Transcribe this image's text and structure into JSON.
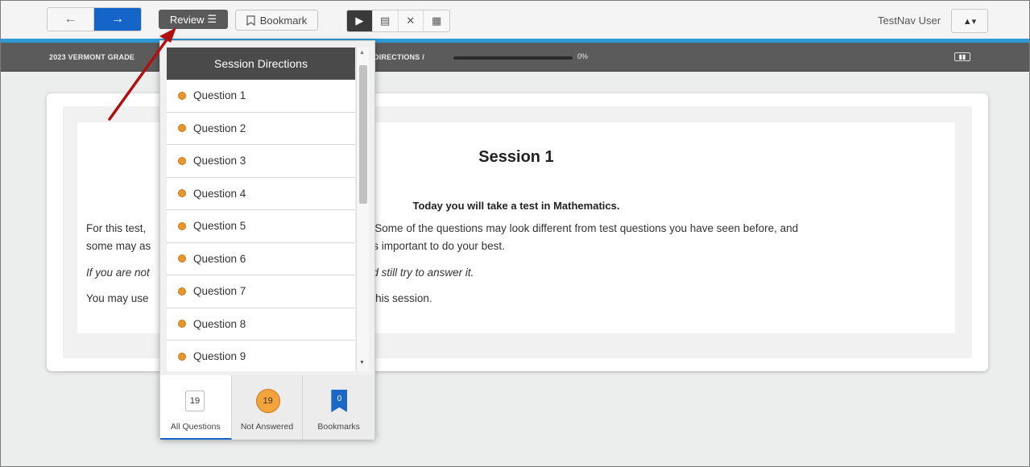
{
  "toolbar": {
    "back_icon": "←",
    "next_icon": "→",
    "review_label": "Review",
    "review_icon": "☰",
    "bookmark_label": "Bookmark",
    "user_name": "TestNav User",
    "user_icon": "▲▾",
    "tools": [
      {
        "name": "pointer-icon",
        "glyph": "▶"
      },
      {
        "name": "notepad-icon",
        "glyph": "▤"
      },
      {
        "name": "answer-eliminator-icon",
        "glyph": "✕"
      },
      {
        "name": "calculator-icon",
        "glyph": "▦"
      }
    ]
  },
  "strip": {
    "test_title": "2023 VERMONT GRADE",
    "section": "DIRECTIONS  /",
    "progress_percent": 0,
    "progress_text": "0%"
  },
  "content": {
    "title": "Session 1",
    "intro": "Today you will take a test in Mathematics.",
    "para1_line1": "For this test,",
    "para1_line1_end": "tions. Some of the questions may look different from test questions you have seen before, and",
    "para1_line2": "some may as",
    "para1_line2_end": "t it is important to do your best.",
    "para2": "If you are not",
    "para2_end": "hould still try to answer it.",
    "para3": "You may use",
    "para3_end": "s in this session."
  },
  "review_panel": {
    "header": "Session Directions",
    "questions": [
      "Question 1",
      "Question 2",
      "Question 3",
      "Question 4",
      "Question 5",
      "Question 6",
      "Question 7",
      "Question 8",
      "Question 9"
    ],
    "tabs": {
      "all": {
        "count": "19",
        "label": "All Questions"
      },
      "not_answered": {
        "count": "19",
        "label": "Not Answered"
      },
      "bookmarks": {
        "count": "0",
        "label": "Bookmarks"
      }
    }
  },
  "colors": {
    "accent_blue": "#1565c8",
    "unanswered_orange": "#f4a43c",
    "annotation_arrow": "#b01010"
  }
}
